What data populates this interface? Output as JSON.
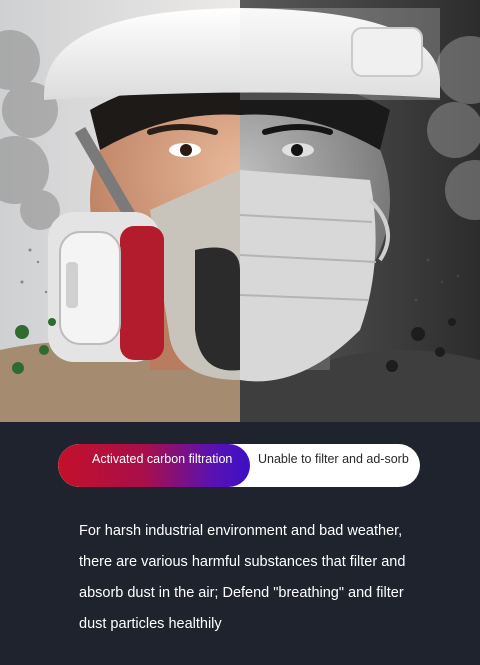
{
  "hero": {
    "image": "split-comparison-face-with-respirator-vs-surgical-mask",
    "left_side": "color-face-with-gas-mask-respirator",
    "right_side": "grayscale-face-with-disposable-mask"
  },
  "comparison": {
    "left_label": "Activated carbon filtration",
    "right_label": "Unable to filter and ad-sorb",
    "left_gradient": [
      "#c4102a",
      "#3a10c8"
    ]
  },
  "description": "For harsh industrial environment and bad weather, there are various harmful substances that filter and absorb dust in the air; Defend \"breathing\" and filter dust particles healthily",
  "colors": {
    "background": "#1e232d",
    "text": "#ffffff"
  }
}
